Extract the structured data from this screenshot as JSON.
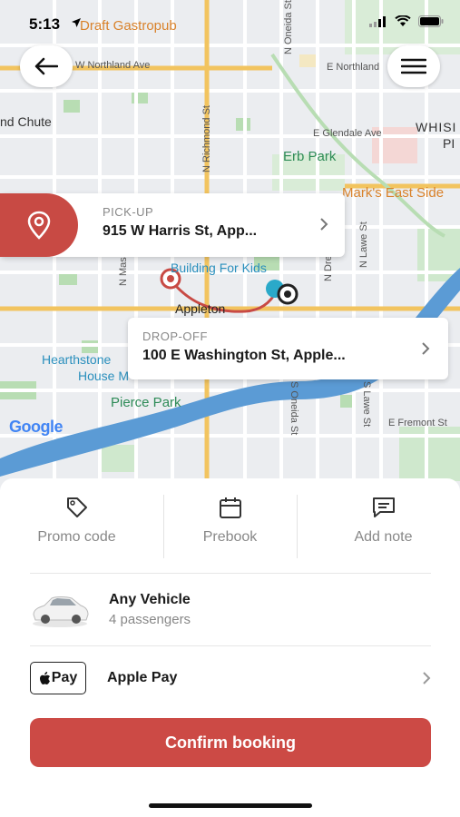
{
  "status_bar": {
    "time": "5:13"
  },
  "map": {
    "labels": {
      "draft_gastropub": "Draft Gastropub",
      "w_northland": "W Northland Ave",
      "e_northland": "E Northland",
      "n_oneida": "N Oneida St",
      "nd_chute": "nd Chute",
      "n_richmond": "N Richmond St",
      "e_glendale": "E Glendale Ave",
      "whisp": "WHISI",
      "pi": "PI",
      "erb_park": "Erb Park",
      "marks_east_side": "Mark's East Side",
      "n_lawe": "N Lawe St",
      "n_dre": "N Dre",
      "n_mas": "N Mas",
      "building_for_kids": "Building For Kids",
      "appleton": "Appleton",
      "hearthstone": "Hearthstone",
      "house_m": "House M",
      "pierce_park": "Pierce Park",
      "s_oneida": "S Oneida St",
      "s_lawe": "S Lawe St",
      "e_fremont": "E Fremont St",
      "google": "Google"
    }
  },
  "pickup": {
    "label": "PICK-UP",
    "address": "915 W Harris St, App..."
  },
  "dropoff": {
    "label": "DROP-OFF",
    "address": "100 E Washington St, Apple..."
  },
  "actions": {
    "promo": "Promo code",
    "prebook": "Prebook",
    "note": "Add note"
  },
  "vehicle": {
    "title": "Any Vehicle",
    "subtitle": "4 passengers"
  },
  "payment": {
    "badge": "Pay",
    "title": "Apple Pay"
  },
  "confirm_label": "Confirm booking",
  "colors": {
    "accent": "#cc4a45",
    "map_water": "#5b9bd5",
    "map_road": "#ffffff",
    "map_major_road": "#f2c45f"
  }
}
